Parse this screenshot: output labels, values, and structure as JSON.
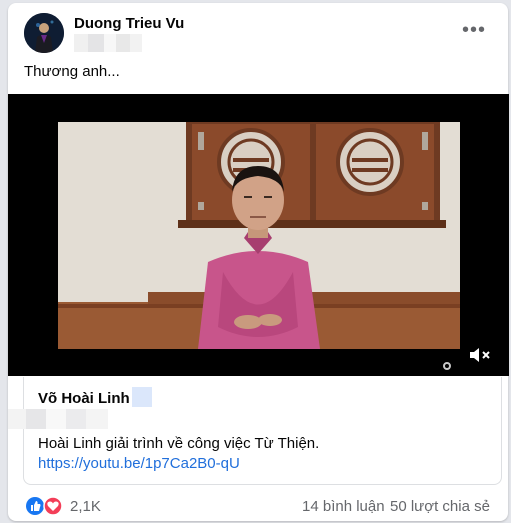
{
  "post": {
    "author": "Duong Trieu Vu",
    "caption": "Thương anh...",
    "more_icon": "more-horizontal-icon"
  },
  "video": {
    "mute_icon": "volume-muted-icon",
    "settings_icon": "settings-gear-icon"
  },
  "link_preview": {
    "title": "Võ Hoài Linh",
    "description": "Hoài Linh giải trình về công việc Từ Thiện.",
    "url": "https://youtu.be/1p7Ca2B0-qU"
  },
  "footer": {
    "reaction_icons": [
      "like-icon",
      "love-icon"
    ],
    "reaction_count": "2,1K",
    "comments": "14 bình luận",
    "shares": "50 lượt chia sẻ"
  },
  "colors": {
    "link": "#216fdb",
    "like": "#1877f2",
    "love": "#f33e58",
    "secondary_text": "#65676b"
  }
}
